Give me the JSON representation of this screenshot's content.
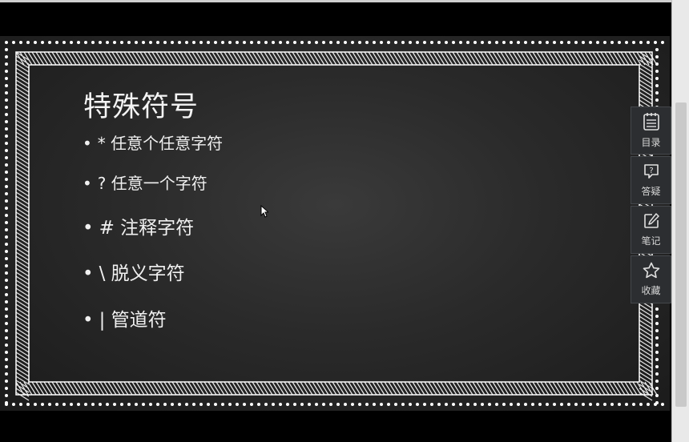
{
  "slide": {
    "title": "特殊符号",
    "bullets": [
      {
        "symbol": "*",
        "text": "任意个任意字符"
      },
      {
        "symbol": "?",
        "text": "任意一个字符"
      },
      {
        "symbol": "#",
        "text": "注释字符"
      },
      {
        "symbol": "\\",
        "text": "脱义字符"
      },
      {
        "symbol": "|",
        "text": "管道符"
      }
    ]
  },
  "toolbar": {
    "items": [
      {
        "label": "目录",
        "icon": "toc-icon"
      },
      {
        "label": "答疑",
        "icon": "question-icon"
      },
      {
        "label": "笔记",
        "icon": "note-edit-icon"
      },
      {
        "label": "收藏",
        "icon": "star-icon"
      }
    ]
  },
  "colors": {
    "slide_background": "#2a2a2a",
    "toolbar_background": "#2c2e31",
    "text": "#f0f0f0"
  }
}
